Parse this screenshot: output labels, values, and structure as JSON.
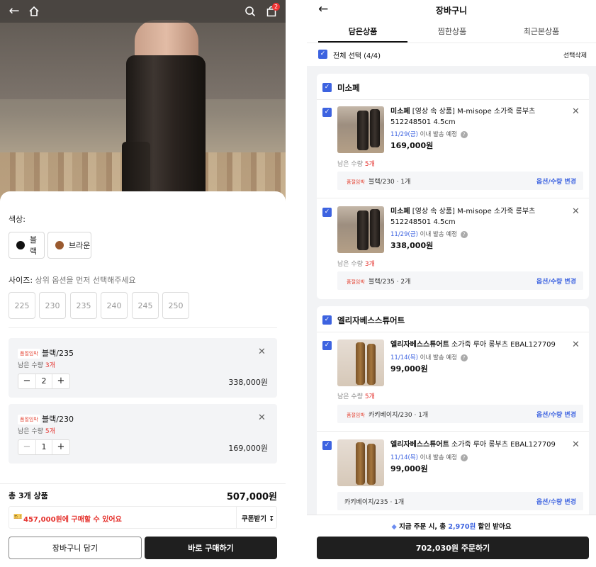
{
  "left": {
    "cart_count": "2",
    "color_label": "색상:",
    "colors": [
      {
        "name": "블랙",
        "swatch": "#111111"
      },
      {
        "name": "브라운",
        "swatch": "#9a5a2f"
      }
    ],
    "size_label": "사이즈:",
    "size_hint": "상위 옵션을 먼저 선택해주세요",
    "sizes": [
      "225",
      "230",
      "235",
      "240",
      "245",
      "250"
    ],
    "selected_options": [
      {
        "tag": "품절임박",
        "option": "블랙/235",
        "remain_prefix": "남은 수량",
        "remain": "3개",
        "qty": "2",
        "price": "338,000원"
      },
      {
        "tag": "품절임박",
        "option": "블랙/230",
        "remain_prefix": "남은 수량",
        "remain": "5개",
        "qty": "1",
        "price": "169,000원"
      }
    ],
    "total_label": "총 3개 상품",
    "total_price": "507,000원",
    "coupon_text": "457,000원에 구매할 수 있어요",
    "coupon_button": "쿠폰받기",
    "cart_button": "장바구니 담기",
    "buy_button": "바로 구매하기"
  },
  "right": {
    "title": "장바구니",
    "tabs": [
      "담은상품",
      "찜한상품",
      "최근본상품"
    ],
    "select_all": "전체 선택 (4/4)",
    "delete_selected": "선택삭제",
    "brands": [
      {
        "name": "미소페",
        "items": [
          {
            "brand": "미소페",
            "name": "[영상 속 상품] M-misope 소가죽 롱부츠 512248501 4.5cm",
            "ship_date": "11/29(금)",
            "ship_suffix": "이내 발송 예정",
            "price": "169,000원",
            "remain_prefix": "남은 수량",
            "remain": "5개",
            "tag": "품절임박",
            "option": "블랙/230 · 1개",
            "change": "옵션/수량 변경"
          },
          {
            "brand": "미소페",
            "name": "[영상 속 상품] M-misope 소가죽 롱부츠 512248501 4.5cm",
            "ship_date": "11/29(금)",
            "ship_suffix": "이내 발송 예정",
            "price": "338,000원",
            "remain_prefix": "남은 수량",
            "remain": "3개",
            "tag": "품절임박",
            "option": "블랙/235 · 2개",
            "change": "옵션/수량 변경"
          }
        ]
      },
      {
        "name": "엘리자베스스튜어트",
        "items": [
          {
            "brand": "엘리자베스스튜어트",
            "name": "소가죽 루아 롱부츠 EBAL127709",
            "ship_date": "11/14(목)",
            "ship_suffix": "이내 발송 예정",
            "price": "99,000원",
            "remain_prefix": "남은 수량",
            "remain": "5개",
            "tag": "품절임박",
            "option": "카키베이지/230 · 1개",
            "change": "옵션/수량 변경"
          },
          {
            "brand": "엘리자베스스튜어트",
            "name": "소가죽 루아 롱부츠 EBAL127709",
            "ship_date": "11/14(목)",
            "ship_suffix": "이내 발송 예정",
            "price": "99,000원",
            "option": "카키베이지/235 · 1개",
            "change": "옵션/수량 변경"
          }
        ]
      }
    ],
    "discount_prefix": "지금 주문 시, 총",
    "discount_amount": "2,970원",
    "discount_suffix": "할인 받아요",
    "order_button": "702,030원 주문하기"
  },
  "colors": {
    "accent": "#3d63e0",
    "danger": "#e5322d",
    "dark": "#1f1f1f"
  }
}
